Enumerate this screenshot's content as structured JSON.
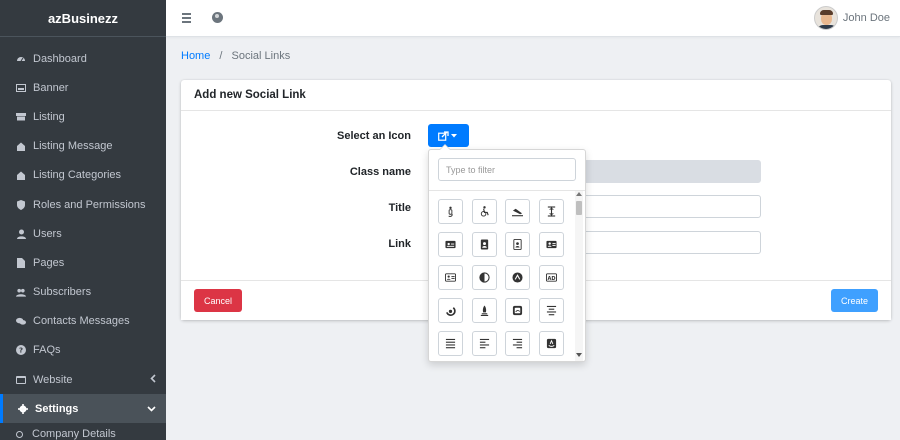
{
  "app": {
    "brand": "azBusinezz",
    "user_name": "John Doe"
  },
  "sidebar": {
    "items": [
      {
        "label": "Dashboard",
        "icon": "tachometer-icon"
      },
      {
        "label": "Banner",
        "icon": "image-icon"
      },
      {
        "label": "Listing",
        "icon": "list-icon"
      },
      {
        "label": "Listing Message",
        "icon": "building-icon"
      },
      {
        "label": "Listing Categories",
        "icon": "building-icon"
      },
      {
        "label": "Roles and Permissions",
        "icon": "shield-icon"
      },
      {
        "label": "Users",
        "icon": "user-icon"
      },
      {
        "label": "Pages",
        "icon": "file-icon"
      },
      {
        "label": "Subscribers",
        "icon": "users-icon"
      },
      {
        "label": "Contacts Messages",
        "icon": "comments-icon"
      },
      {
        "label": "FAQs",
        "icon": "question-circle-icon"
      },
      {
        "label": "Website",
        "icon": "window-icon",
        "has_children": true
      },
      {
        "label": "Settings",
        "icon": "cog-icon",
        "has_children": true,
        "active": true
      }
    ],
    "sub_items": [
      {
        "label": "Company Details"
      }
    ]
  },
  "breadcrumb": {
    "home": "Home",
    "sep": "/",
    "current": "Social Links"
  },
  "card": {
    "title": "Add new Social Link",
    "labels": {
      "icon": "Select an Icon",
      "class_name": "Class name",
      "title": "Title",
      "link": "Link"
    },
    "cancel_label": "Cancel",
    "create_label": "Create"
  },
  "icon_picker": {
    "filter_placeholder": "Type to filter",
    "icons": [
      "accessible-icon",
      "wheelchair-icon",
      "plane-arrival-icon",
      "text-height-icon",
      "id-badge-icon",
      "address-book-icon",
      "address-book-alt-icon",
      "address-card-icon",
      "id-card-icon",
      "adjust-icon",
      "airbnb-icon",
      "ad-icon",
      "algolia-icon",
      "align-center-rocket-icon",
      "alipay-icon",
      "align-center-icon",
      "align-justify-icon",
      "align-left-icon",
      "align-right-icon",
      "amazon-icon"
    ]
  },
  "colors": {
    "primary": "#007bff",
    "danger": "#dc3545",
    "sidebar": "#343a40"
  }
}
